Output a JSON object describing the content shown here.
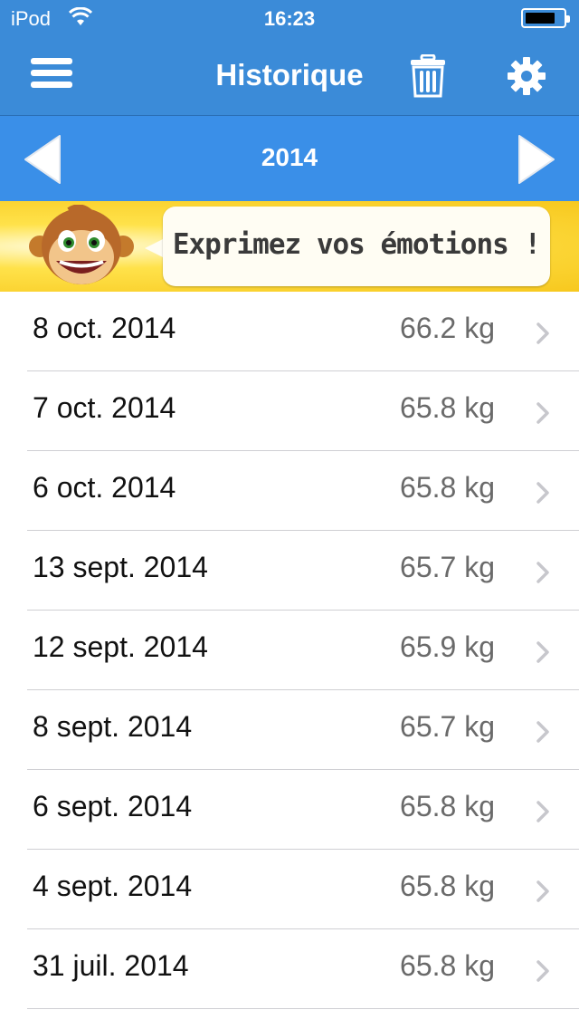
{
  "status": {
    "carrier": "iPod",
    "time": "16:23"
  },
  "navbar": {
    "title": "Historique"
  },
  "yearbar": {
    "year": "2014"
  },
  "banner": {
    "text": "Exprimez vos émotions !"
  },
  "entries": [
    {
      "date": "8 oct. 2014",
      "weight": "66.2 kg"
    },
    {
      "date": "7 oct. 2014",
      "weight": "65.8 kg"
    },
    {
      "date": "6 oct. 2014",
      "weight": "65.8 kg"
    },
    {
      "date": "13 sept. 2014",
      "weight": "65.7 kg"
    },
    {
      "date": "12 sept. 2014",
      "weight": "65.9 kg"
    },
    {
      "date": "8 sept. 2014",
      "weight": "65.7 kg"
    },
    {
      "date": "6 sept. 2014",
      "weight": "65.8 kg"
    },
    {
      "date": "4 sept. 2014",
      "weight": "65.8 kg"
    },
    {
      "date": "31 juil. 2014",
      "weight": "65.8 kg"
    }
  ],
  "colors": {
    "nav": "#3b8bd8",
    "yearbar": "#3a8fe8",
    "banner": "#f7c81e"
  },
  "icons": [
    "wifi-icon",
    "battery-icon",
    "menu-icon",
    "trash-icon",
    "gear-icon",
    "chevron-left-icon",
    "chevron-right-icon",
    "monkey-icon",
    "chevron-right-icon"
  ]
}
